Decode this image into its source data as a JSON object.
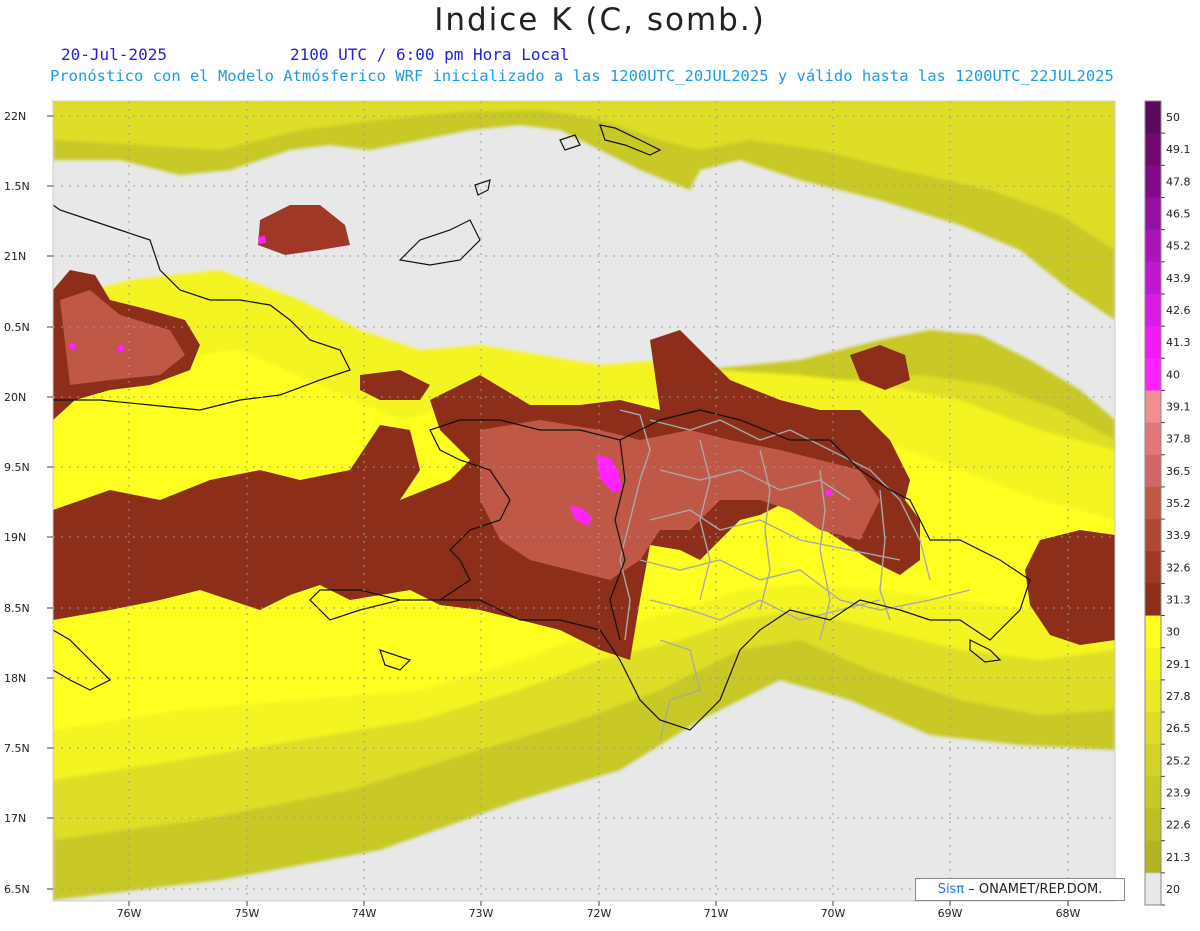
{
  "header": {
    "title": "Indice K (C, somb.)",
    "date": "20-Jul-2025",
    "utc_time": "2100 UTC / 6:00 pm Hora Local",
    "description": "Pronóstico con el Modelo Atmósferico WRF inicializado a las 1200UTC_20JUL2025 y válido hasta las  1200UTC_22JUL2025"
  },
  "axes": {
    "lat_labels": [
      "22N",
      "1.5N",
      "21N",
      "0.5N",
      "20N",
      "9.5N",
      "19N",
      "8.5N",
      "18N",
      "7.5N",
      "17N",
      "6.5N"
    ],
    "lon_labels": [
      "76W",
      "75W",
      "74W",
      "73W",
      "72W",
      "71W",
      "70W",
      "69W",
      "68W"
    ]
  },
  "colorbar": {
    "labels": [
      "50",
      "49.1",
      "47.8",
      "46.5",
      "45.2",
      "43.9",
      "42.6",
      "41.3",
      "40",
      "39.1",
      "37.8",
      "36.5",
      "35.2",
      "33.9",
      "32.6",
      "31.3",
      "30",
      "29.1",
      "27.8",
      "26.5",
      "25.2",
      "23.9",
      "22.6",
      "21.3",
      "20"
    ],
    "colors": [
      "#5c0a5c",
      "#6e0a70",
      "#800a88",
      "#9410a0",
      "#aa14b8",
      "#c018d0",
      "#d81ce4",
      "#ee1ef0",
      "#ff24ff",
      "#f09090",
      "#e07878",
      "#d06868",
      "#c05848",
      "#b04838",
      "#a03828",
      "#8c2e1a",
      "#ffff22",
      "#f4f420",
      "#e8e826",
      "#dede28",
      "#d2d228",
      "#c8c826",
      "#bebe24",
      "#b4b422"
    ],
    "missing_color": "#e8e8e8"
  },
  "credit": {
    "brand": "Sisπ",
    "text": " – ONAMET/REP.DOM."
  }
}
